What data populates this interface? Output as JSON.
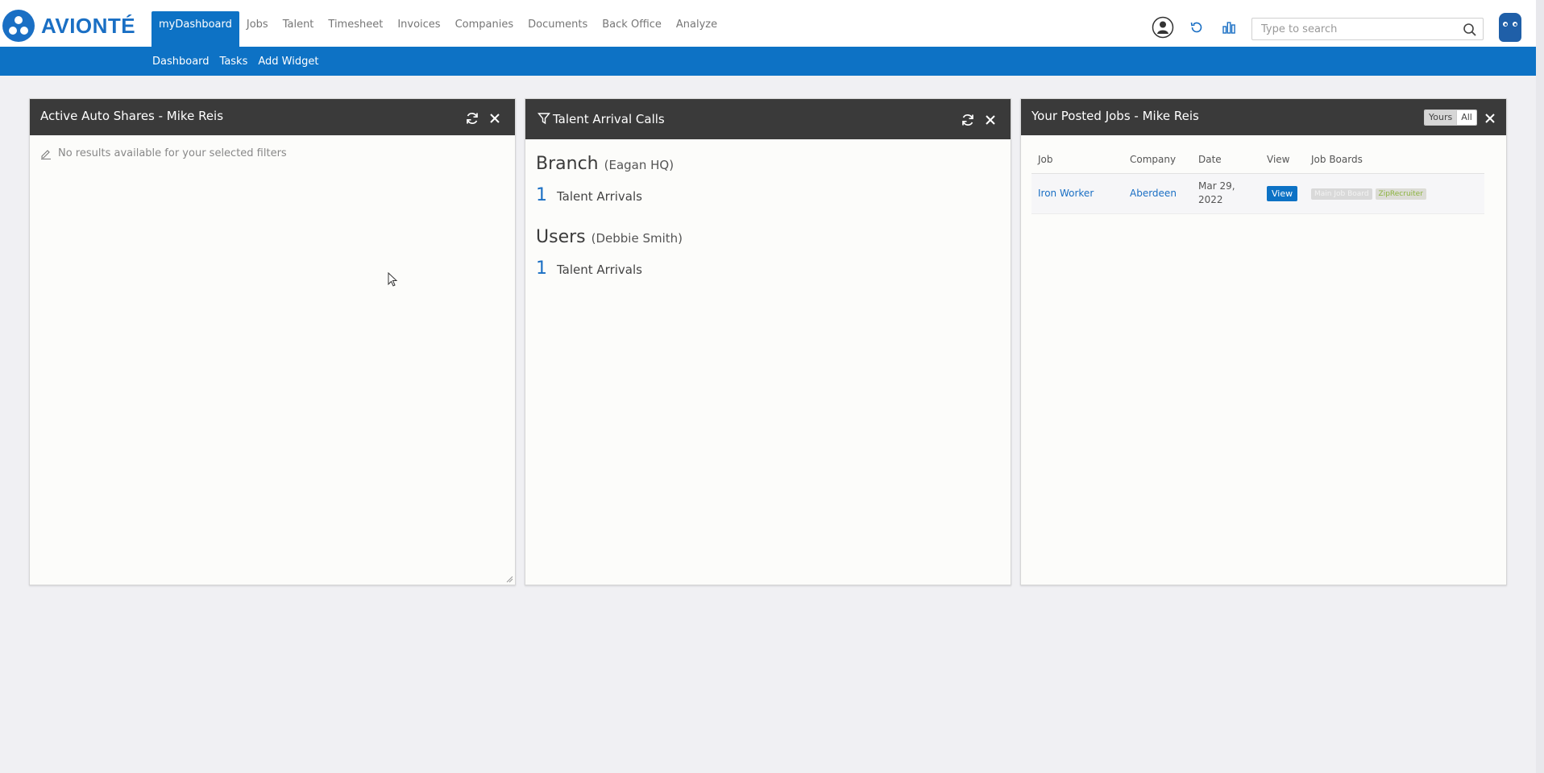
{
  "app": {
    "brand": "AVIONTÉ",
    "nav": [
      "myDashboard",
      "Jobs",
      "Talent",
      "Timesheet",
      "Invoices",
      "Companies",
      "Documents",
      "Back Office",
      "Analyze"
    ],
    "search_placeholder": "Type to search",
    "subnav": [
      "Dashboard",
      "Tasks",
      "Add Widget"
    ],
    "accent": "#0d72c5"
  },
  "widgets": {
    "auto_shares": {
      "title": "Active Auto Shares - Mike Reis",
      "empty_message": "No results available for your selected filters"
    },
    "talent_arrival": {
      "title": "Talent Arrival Calls",
      "branch_label": "Branch",
      "branch_value": "(Eagan HQ)",
      "branch_count": "1",
      "branch_count_label": "Talent Arrivals",
      "users_label": "Users",
      "users_value": "(Debbie Smith)",
      "users_count": "1",
      "users_count_label": "Talent Arrivals"
    },
    "posted_jobs": {
      "title": "Your Posted Jobs - Mike Reis",
      "toggle_yours": "Yours",
      "toggle_all": "All",
      "columns": [
        "Job",
        "Company",
        "Date",
        "View",
        "Job Boards"
      ],
      "rows": [
        {
          "job": "Iron Worker",
          "company": "Aberdeen",
          "date_line1": "Mar 29,",
          "date_line2": "2022",
          "view": "View",
          "boards": [
            "Main Job Board",
            "ZipRecruiter"
          ]
        }
      ]
    }
  }
}
